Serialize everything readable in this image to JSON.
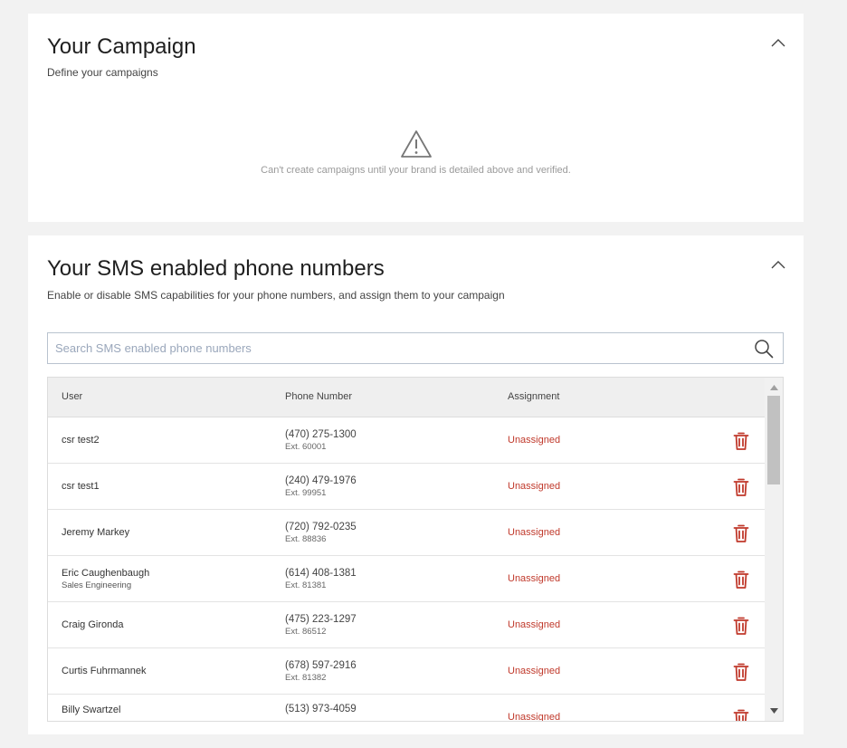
{
  "campaign": {
    "title": "Your Campaign",
    "subtitle": "Define your campaigns",
    "empty_message": "Can't create campaigns until your brand is detailed above and verified."
  },
  "sms": {
    "title": "Your SMS enabled phone numbers",
    "subtitle": "Enable or disable SMS capabilities for your phone numbers, and assign them to your campaign",
    "search_placeholder": "Search SMS enabled phone numbers",
    "columns": {
      "user": "User",
      "phone": "Phone Number",
      "assignment": "Assignment"
    },
    "rows": [
      {
        "user": "csr test2",
        "dept": "",
        "phone": "(470) 275-1300",
        "ext": "Ext. 60001",
        "assignment": "Unassigned"
      },
      {
        "user": "csr test1",
        "dept": "",
        "phone": "(240) 479-1976",
        "ext": "Ext. 99951",
        "assignment": "Unassigned"
      },
      {
        "user": "Jeremy Markey",
        "dept": "",
        "phone": "(720) 792-0235",
        "ext": "Ext. 88836",
        "assignment": "Unassigned"
      },
      {
        "user": "Eric Caughenbaugh",
        "dept": "Sales Engineering",
        "phone": "(614) 408-1381",
        "ext": "Ext. 81381",
        "assignment": "Unassigned"
      },
      {
        "user": "Craig Gironda",
        "dept": "",
        "phone": "(475) 223-1297",
        "ext": "Ext. 86512",
        "assignment": "Unassigned"
      },
      {
        "user": "Curtis Fuhrmannek",
        "dept": "",
        "phone": "(678) 597-2916",
        "ext": "Ext. 81382",
        "assignment": "Unassigned"
      },
      {
        "user": "Billy Swartzel",
        "dept": "",
        "phone": "(513) 973-4059",
        "ext": "",
        "assignment": "Unassigned"
      }
    ]
  },
  "colors": {
    "accent_red": "#c0392b",
    "card_bg": "#ffffff",
    "page_bg": "#f2f2f2"
  },
  "icons": {
    "collapse": "chevron-up-icon",
    "warning": "warning-icon",
    "search": "search-icon",
    "delete": "trash-icon"
  }
}
